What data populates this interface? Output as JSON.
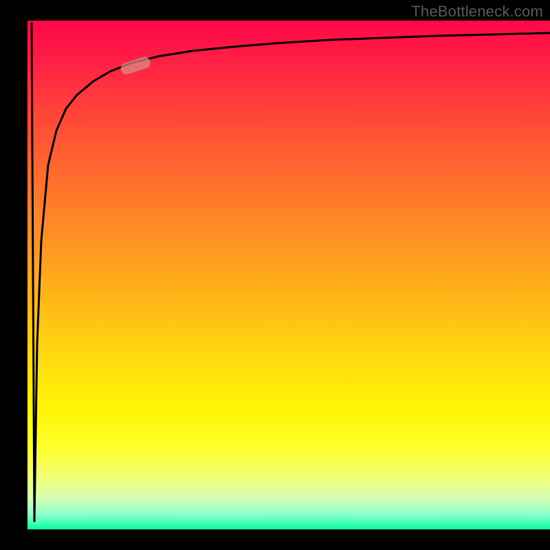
{
  "watermark": "TheBottleneck.com",
  "chart_data": {
    "type": "line",
    "title": "",
    "xlabel": "",
    "ylabel": "",
    "xlim": [
      0,
      100
    ],
    "ylim": [
      0,
      100
    ],
    "x": [
      0,
      0.5,
      1,
      1.5,
      2,
      3,
      4,
      5,
      6,
      8,
      10,
      12,
      15,
      20,
      25,
      30,
      40,
      50,
      60,
      70,
      80,
      90,
      100
    ],
    "values": [
      100,
      50,
      0,
      35,
      55,
      70,
      78,
      82,
      85,
      88,
      90,
      91.5,
      92.5,
      93.5,
      94.2,
      94.8,
      95.5,
      96,
      96.3,
      96.6,
      96.8,
      97,
      97.2
    ],
    "marker": {
      "x": 19,
      "y": 91.5
    },
    "background_gradient": {
      "top": "#ff0748",
      "mid": "#ffd400",
      "bottom": "#09ff9c"
    }
  }
}
